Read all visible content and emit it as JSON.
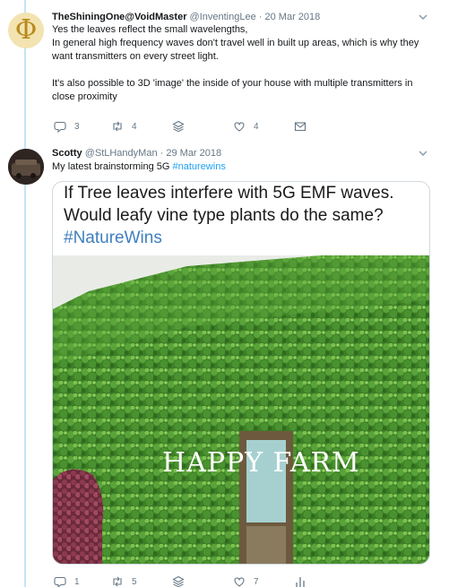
{
  "tweets": [
    {
      "name": "TheShiningOne@VoidMaster",
      "handle": "@InventingLee",
      "separator": "·",
      "date": "20 Mar 2018",
      "lines": [
        "Yes the leaves reflect the small wavelengths,",
        "In general high frequency waves don't travel well in built up areas, which is why they want transmitters on every street light.",
        "",
        "It's also possible to 3D 'image' the inside of your house with multiple transmitters in close proximity"
      ],
      "reply_count": "3",
      "retweet_count": "4",
      "like_count": "4",
      "avatar_icon": "phi-symbol-icon",
      "icons": [
        "chevron-down-icon",
        "reply-icon",
        "retweet-icon",
        "stack-icon",
        "heart-icon",
        "message-icon"
      ]
    },
    {
      "name": "Scotty",
      "handle": "@StLHandyMan",
      "separator": "·",
      "date": "29 Mar 2018",
      "text": "My latest brainstorming 5G ",
      "hashtag": "#naturewins",
      "image_caption": "If Tree leaves interfere with 5G EMF waves. Would leafy vine type plants do the same?",
      "image_caption_tag": "#NatureWins",
      "image_watermark": "HAPPY FARM",
      "reply_count": "1",
      "retweet_count": "5",
      "like_count": "7",
      "icons": [
        "chevron-down-icon",
        "reply-icon",
        "retweet-icon",
        "stack-icon",
        "heart-icon",
        "analytics-icon"
      ]
    }
  ],
  "colors": {
    "thread_line": "#c4e3f7",
    "link": "#1da1f2",
    "secondary_text": "#657786",
    "ivy_green": "#3f8a2c"
  }
}
